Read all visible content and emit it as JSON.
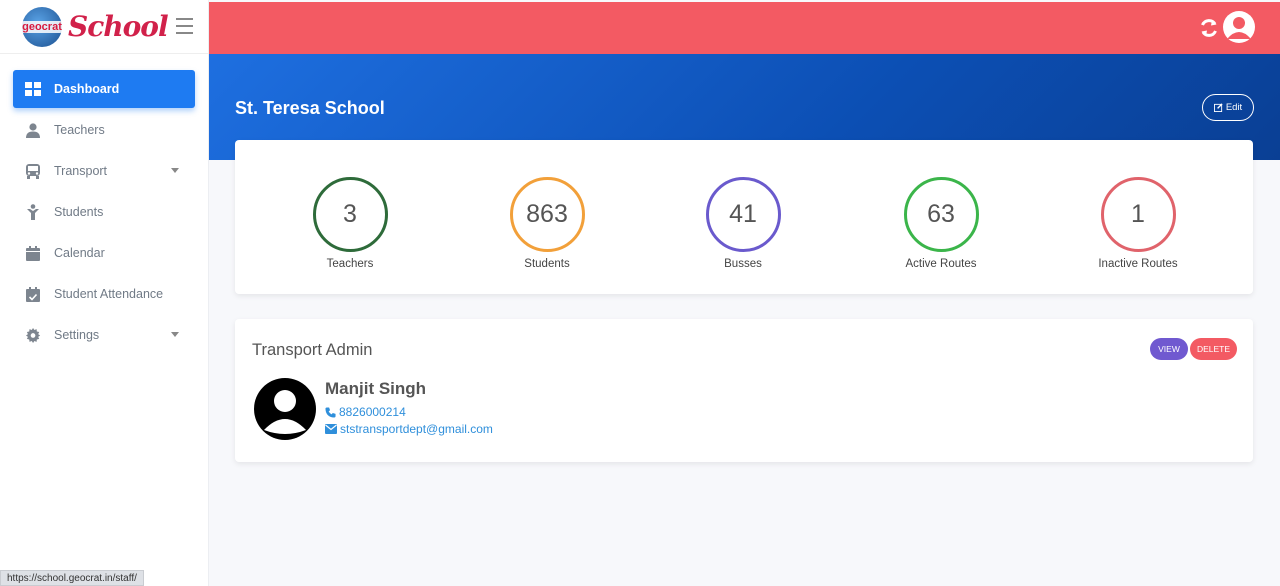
{
  "brand": {
    "globe_text": "geocrat",
    "name": "School",
    "color": "#d1214a"
  },
  "sidebar": {
    "items": [
      {
        "label": "Dashboard",
        "icon": "dashboard-icon",
        "active": true
      },
      {
        "label": "Teachers",
        "icon": "person-icon"
      },
      {
        "label": "Transport",
        "icon": "bus-icon",
        "dropdown": true
      },
      {
        "label": "Students",
        "icon": "student-icon"
      },
      {
        "label": "Calendar",
        "icon": "calendar-icon"
      },
      {
        "label": "Student Attendance",
        "icon": "calendar-check-icon"
      },
      {
        "label": "Settings",
        "icon": "gear-icon",
        "dropdown": true
      }
    ]
  },
  "topbar": {
    "color": "#f35a63",
    "icons": [
      "refresh-icon",
      "user-icon"
    ]
  },
  "hero": {
    "school_name": "St. Teresa School",
    "edit_label": "Edit"
  },
  "stats": [
    {
      "value": "3",
      "label": "Teachers",
      "color": "#2e6b3a"
    },
    {
      "value": "863",
      "label": "Students",
      "color": "#f2a03a"
    },
    {
      "value": "41",
      "label": "Busses",
      "color": "#6a5acd"
    },
    {
      "value": "63",
      "label": "Active Routes",
      "color": "#3bb54a"
    },
    {
      "value": "1",
      "label": "Inactive Routes",
      "color": "#e0636b"
    }
  ],
  "admin": {
    "heading": "Transport Admin",
    "view_label": "VIEW",
    "delete_label": "DELETE",
    "name": "Manjit Singh",
    "phone": "8826000214",
    "email": "ststransportdept@gmail.com"
  },
  "status_bar": {
    "url": "https://school.geocrat.in/staff/"
  }
}
